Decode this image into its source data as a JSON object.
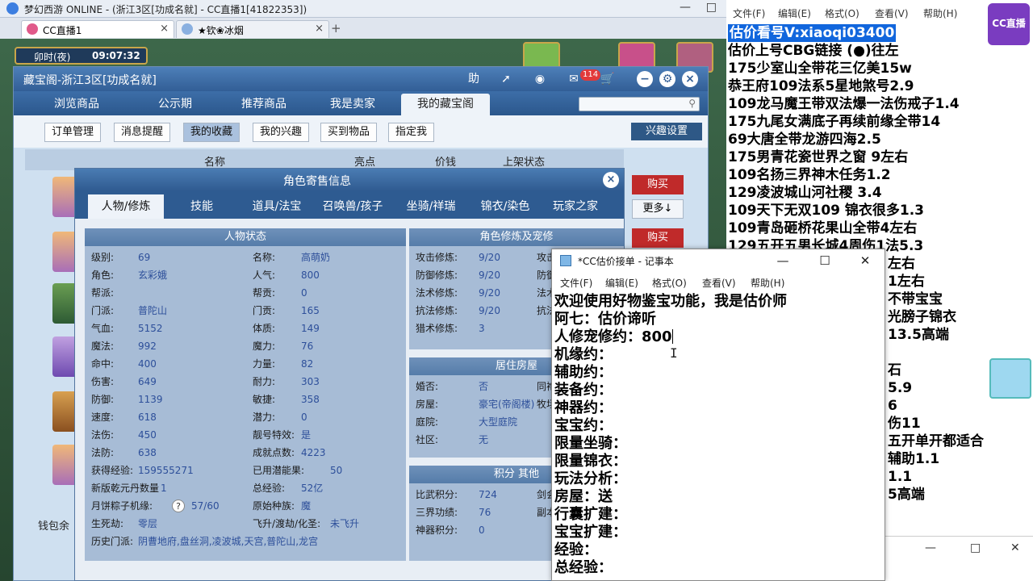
{
  "game": {
    "window_title": "梦幻西游 ONLINE - (浙江3区[功成名就] - CC直播1[41822353])",
    "tabs": [
      {
        "label": "CC直播1",
        "active": true
      },
      {
        "label": "★钦❀冰烟",
        "active": false
      }
    ],
    "hud": {
      "period": "卯时(夜)",
      "clock": "09:07:32"
    }
  },
  "cbg": {
    "title": "藏宝阁-浙江3区[功成名就]",
    "help_label": "助",
    "badge_count": "114",
    "nav_tabs": [
      "浏览商品",
      "公示期",
      "推荐商品",
      "我是卖家",
      "我的藏宝阁"
    ],
    "active_nav": "我的藏宝阁",
    "sub_tabs": [
      "订单管理",
      "消息提醒",
      "我的收藏",
      "我的兴趣",
      "买到物品",
      "指定我"
    ],
    "active_sub": "我的收藏",
    "interest_settings": "兴趣设置",
    "list_columns": [
      "名称",
      "亮点",
      "价钱",
      "上架状态"
    ],
    "buy_label": "购买",
    "more_label": "更多↓",
    "wallet_label": "钱包余"
  },
  "role_info": {
    "title": "角色寄售信息",
    "tabs": [
      "人物/修炼",
      "技能",
      "道具/法宝",
      "召唤兽/孩子",
      "坐骑/祥瑞",
      "锦衣/染色",
      "玩家之家"
    ],
    "active_tab": "人物/修炼",
    "status_header": "人物状态",
    "status_left": [
      {
        "k": "级别:",
        "v": "69"
      },
      {
        "k": "角色:",
        "v": "玄彩娥"
      },
      {
        "k": "帮派:",
        "v": ""
      },
      {
        "k": "门派:",
        "v": "普陀山"
      },
      {
        "k": "气血:",
        "v": "5152"
      },
      {
        "k": "魔法:",
        "v": "992"
      },
      {
        "k": "命中:",
        "v": "400"
      },
      {
        "k": "伤害:",
        "v": "649"
      },
      {
        "k": "防御:",
        "v": "1139"
      },
      {
        "k": "速度:",
        "v": "618"
      },
      {
        "k": "法伤:",
        "v": "450"
      },
      {
        "k": "法防:",
        "v": "638"
      },
      {
        "k": "获得经验:",
        "v": "159555271"
      },
      {
        "k": "新版乾元丹数量",
        "v": "1"
      },
      {
        "k": "月饼粽子机缘:",
        "v": "57/60"
      },
      {
        "k": "生死劫:",
        "v": "零层"
      },
      {
        "k": "历史门派:",
        "v": "阴曹地府,盘丝洞,凌波城,天宫,普陀山,龙宫"
      }
    ],
    "status_right": [
      {
        "k": "名称:",
        "v": "高萌奶"
      },
      {
        "k": "人气:",
        "v": "800"
      },
      {
        "k": "帮贡:",
        "v": "0"
      },
      {
        "k": "门贡:",
        "v": "165"
      },
      {
        "k": "体质:",
        "v": "149"
      },
      {
        "k": "魔力:",
        "v": "76"
      },
      {
        "k": "力量:",
        "v": "82"
      },
      {
        "k": "耐力:",
        "v": "303"
      },
      {
        "k": "敏捷:",
        "v": "358"
      },
      {
        "k": "潜力:",
        "v": "0"
      },
      {
        "k": "靓号特效:",
        "v": "是"
      },
      {
        "k": "成就点数:",
        "v": "4223"
      },
      {
        "k": "已用潜能果:",
        "v": "50"
      },
      {
        "k": "总经验:",
        "v": "52亿"
      },
      {
        "k": "原始种族:",
        "v": "魔"
      },
      {
        "k": "飞升/渡劫/化圣:",
        "v": "未飞升"
      }
    ],
    "cultivation_header": "角色修炼及宠修",
    "cultivation": [
      {
        "k": "攻击修炼:",
        "v": "9/20",
        "k2": "攻击"
      },
      {
        "k": "防御修炼:",
        "v": "9/20",
        "k2": "防御"
      },
      {
        "k": "法术修炼:",
        "v": "9/20",
        "k2": "法术"
      },
      {
        "k": "抗法修炼:",
        "v": "9/20",
        "k2": "抗法"
      },
      {
        "k": "猎术修炼:",
        "v": "3",
        "k2": ""
      }
    ],
    "house_header": "居住房屋",
    "house": [
      {
        "k": "婚否:",
        "v": "否",
        "k2": "同袍"
      },
      {
        "k": "房屋:",
        "v": "豪宅(帝阁楼)",
        "k2": "牧场"
      },
      {
        "k": "庭院:",
        "v": "大型庭院",
        "k2": ""
      },
      {
        "k": "社区:",
        "v": "无",
        "k2": ""
      }
    ],
    "score_header": "积分 其他",
    "score": [
      {
        "k": "比武积分:",
        "v": "724",
        "k2": "剑会"
      },
      {
        "k": "三界功绩:",
        "v": "76",
        "k2": "副本"
      },
      {
        "k": "神器积分:",
        "v": "0",
        "k2": ""
      }
    ],
    "help_glyph": "?"
  },
  "notepad1": {
    "menu": [
      "文件(F)",
      "编辑(E)",
      "格式(O)",
      "查看(V)",
      "帮助(H)"
    ],
    "lines": [
      "估价看号V:xiaoqi03400",
      "估价上号CBG链接 (●)往左",
      "175少室山全带花三亿美15w",
      "恭王府109法系5星地煞号2.9",
      "109龙马魔王带双法爆一法伤戒子1.4",
      "175九尾女满底子再续前缘全带14",
      "69大唐全带龙游四海2.5",
      "175男青花瓷世界之窗  9左右",
      "109名扬三界神木任务1.2",
      "129凌波城山河社稷  3.4",
      "109天下无双109  锦衣很多1.3",
      "109青岛砸桥花果山全带4左右",
      "129五开五男长城4周伤1法5.3"
    ],
    "peek_lines": [
      "左右",
      "1左右",
      "不带宝宝",
      "光膀子锦衣",
      "13.5高端",
      "",
      "石",
      "5.9",
      "6",
      "伤11",
      "五开单开都适合",
      "辅助1.1",
      "1.1",
      "5高端"
    ],
    "logo_text": "CC直播"
  },
  "notepad2": {
    "title": "*CC估价接单 - 记事本",
    "menu": [
      "文件(F)",
      "编辑(E)",
      "格式(O)",
      "查看(V)",
      "帮助(H)"
    ],
    "lines": [
      "欢迎使用好物鉴宝功能，我是估价师",
      "阿七：估价谛听",
      "人修宠修约：800",
      "机缘约：",
      "辅助约：",
      "装备约：",
      "神器约：",
      "宝宝约：",
      "限量坐骑：",
      "限量锦衣：",
      "玩法分析：",
      "房屋：送",
      "行囊扩建：",
      "宝宝扩建：",
      "经验：",
      "总经验："
    ]
  },
  "colors": {
    "accent_blue": "#325e96",
    "value_blue": "#2d4f9a",
    "buy_red": "#c02a2a",
    "selection": "#1166dd"
  }
}
